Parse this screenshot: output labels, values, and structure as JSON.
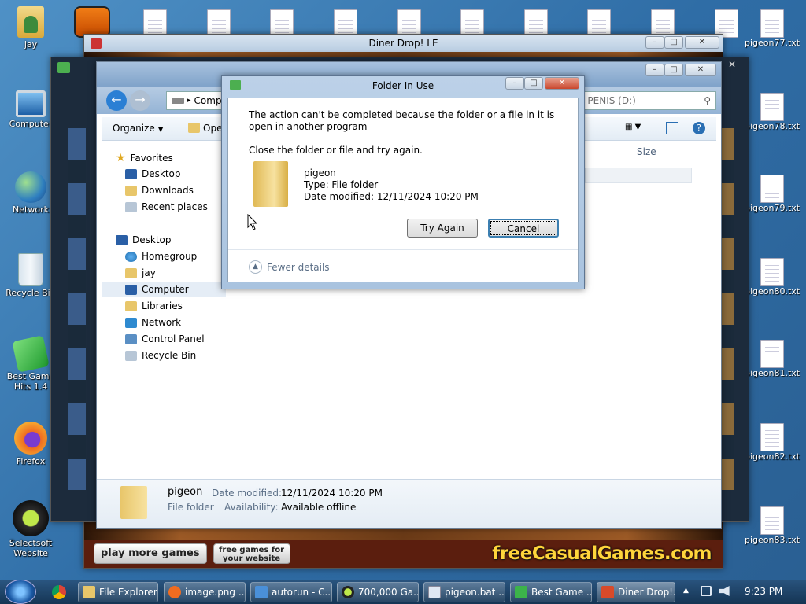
{
  "desktop": {
    "icons": [
      {
        "label": "jay"
      },
      {
        "label": "Computer"
      },
      {
        "label": "Network"
      },
      {
        "label": "Recycle Bin"
      },
      {
        "label": "Best Game Hits 1.4"
      },
      {
        "label": "Firefox"
      },
      {
        "label": "Selectsoft Website"
      }
    ],
    "files": [
      "pigeon77.txt",
      "pigeon78.txt",
      "pigeon79.txt",
      "pigeon80.txt",
      "pigeon81.txt",
      "pigeon82.txt",
      "pigeon83.txt"
    ],
    "colors": {
      "accent": "#2f6da6"
    }
  },
  "game_window": {
    "title": "Diner Drop! LE",
    "footer": {
      "play_more": "play more games",
      "free_games": "free games for your website",
      "brand": "freeCasualGames.com"
    }
  },
  "explorer": {
    "address": "Comp",
    "address_right": "h PENIS (D:)",
    "toolbar": {
      "organize": "Organize",
      "open": "Ope"
    },
    "column_size": "Size",
    "nav": {
      "favorites": "Favorites",
      "desktop": "Desktop",
      "downloads": "Downloads",
      "recent": "Recent places",
      "desktop2": "Desktop",
      "homegroup": "Homegroup",
      "jay": "jay",
      "computer": "Computer",
      "libraries": "Libraries",
      "network": "Network",
      "control_panel": "Control Panel",
      "recycle_bin": "Recycle Bin"
    },
    "details": {
      "name": "pigeon",
      "type": "File folder",
      "date_label": "Date modified:",
      "date_value": "12/11/2024 10:20 PM",
      "avail_label": "Availability:",
      "avail_value": "Available offline"
    }
  },
  "dialog": {
    "title": "Folder In Use",
    "message": "The action can't be completed because the folder or a file in it is open in another program",
    "instruction": "Close the folder or file and try again.",
    "item_name": "pigeon",
    "item_type": "Type: File folder",
    "item_date": "Date modified: 12/11/2024 10:20 PM",
    "try_again": "Try Again",
    "cancel": "Cancel",
    "fewer_details": "Fewer details"
  },
  "taskbar": {
    "items": [
      {
        "label": "File Explorer"
      },
      {
        "label": "image.png ..."
      },
      {
        "label": "autorun - C..."
      },
      {
        "label": "700,000 Ga..."
      },
      {
        "label": "pigeon.bat ..."
      },
      {
        "label": "Best Game ..."
      },
      {
        "label": "Diner Drop!..."
      }
    ],
    "clock": "9:23 PM"
  }
}
